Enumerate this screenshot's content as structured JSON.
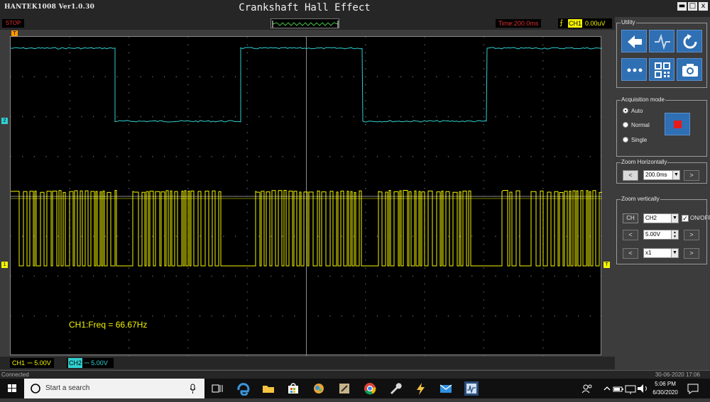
{
  "window": {
    "app_version": "HANTEK1008 Ver1.0.30",
    "title": "Crankshaft Hall Effect",
    "min_label": "▬",
    "max_label": "□",
    "close_label": "x"
  },
  "status": {
    "run_state": "STOP",
    "time_base": "Time:200.0ms",
    "trigger_channel": "CH1",
    "trigger_level": "0.00uV"
  },
  "screen": {
    "frequency_readout": "CH1:Freq = 66.67Hz",
    "marker_trigger_pos": "T",
    "marker_ch2": "2",
    "marker_ch1": "1",
    "marker_trigger_level": "T"
  },
  "channels": {
    "ch1": {
      "label": "CH1",
      "scale": "5.00V",
      "color": "#f5f500"
    },
    "ch2": {
      "label": "CH2",
      "scale": "5.00V",
      "color": "#30d0d0"
    }
  },
  "panel": {
    "utility_title": "Utility",
    "acquisition_title": "Acquisition mode",
    "modes": [
      "Auto",
      "Normal",
      "Single"
    ],
    "selected_mode": "Auto",
    "zoom_h_title": "Zoom Horizontally",
    "zoom_h_value": "200.0ms",
    "zoom_v_title": "Zoom vertically",
    "ch_button": "CH",
    "zoom_v_channel": "CH2",
    "onoff_label": "ON/OFF",
    "volt_value": "5.00V",
    "probe_value": "x1",
    "prev": "<",
    "next": ">"
  },
  "statusbar": {
    "connection": "Connected",
    "datetime": "30-06-2020 17:06"
  },
  "taskbar": {
    "search_placeholder": "Start a search",
    "clock_time": "5:06 PM",
    "clock_date": "6/30/2020"
  },
  "colors": {
    "accent_blue": "#2f6fb3",
    "stop_red": "#e61a1a"
  }
}
